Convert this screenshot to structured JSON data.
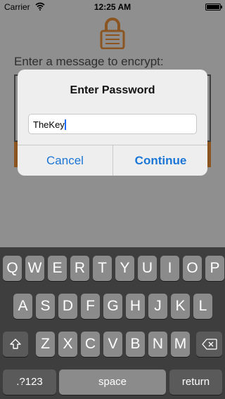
{
  "status_bar": {
    "carrier": "Carrier",
    "time": "12:25 AM"
  },
  "app": {
    "prompt": "Enter a message to encrypt:"
  },
  "alert": {
    "title": "Enter Password",
    "field_value": "TheKey",
    "cancel_label": "Cancel",
    "continue_label": "Continue"
  },
  "keyboard": {
    "row1": [
      "Q",
      "W",
      "E",
      "R",
      "T",
      "Y",
      "U",
      "I",
      "O",
      "P"
    ],
    "row2": [
      "A",
      "S",
      "D",
      "F",
      "G",
      "H",
      "J",
      "K",
      "L"
    ],
    "row3": [
      "Z",
      "X",
      "C",
      "V",
      "B",
      "N",
      "M"
    ],
    "numbers_label": ".?123",
    "space_label": "space",
    "return_label": "return"
  },
  "icons": [
    "wifi-icon",
    "battery-icon",
    "lock-icon",
    "shift-icon",
    "delete-icon"
  ],
  "colors": {
    "accent": "#1a76d6",
    "lock_brown": "#8a5520"
  }
}
